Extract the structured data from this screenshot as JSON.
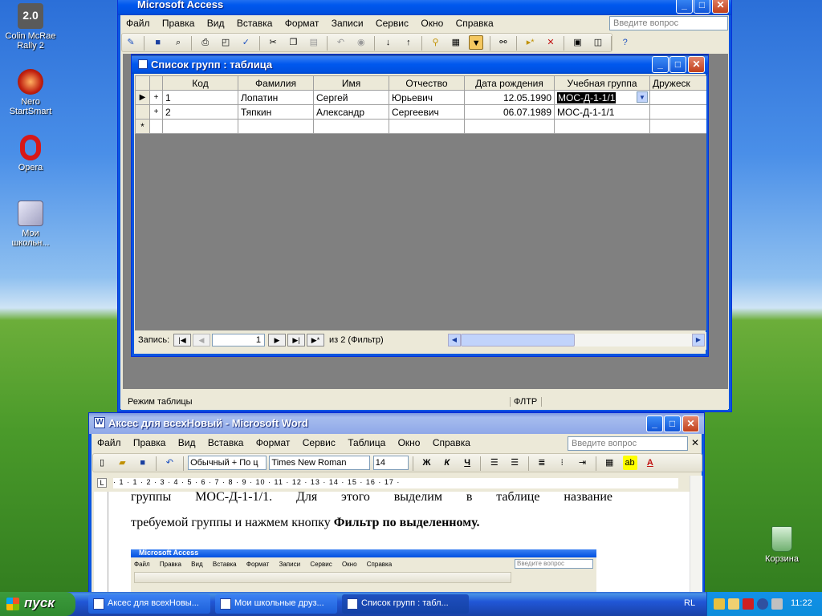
{
  "desktop": {
    "icons": [
      {
        "label": "Colin McRae\nRally 2",
        "badge": "2.0"
      },
      {
        "label": "Nero\nStartSmart"
      },
      {
        "label": "Opera"
      },
      {
        "label": "Мои\nшкольн..."
      },
      {
        "label": "Корзина"
      }
    ]
  },
  "access": {
    "title": "Microsoft Access",
    "menu": [
      "Файл",
      "Правка",
      "Вид",
      "Вставка",
      "Формат",
      "Записи",
      "Сервис",
      "Окно",
      "Справка"
    ],
    "ask_placeholder": "Введите вопрос",
    "status_left": "Режим таблицы",
    "status_mid": "ФЛТР",
    "table_window": {
      "title": "Список групп : таблица",
      "columns": [
        "Код",
        "Фамилия",
        "Имя",
        "Отчество",
        "Дата рождения",
        "Учебная группа",
        "Дружеск"
      ],
      "rows": [
        {
          "kod": "1",
          "familia": "Лопатин",
          "imya": "Сергей",
          "otchestvo": "Юрьевич",
          "date": "12.05.1990",
          "group": "МОС-Д-1-1/1"
        },
        {
          "kod": "2",
          "familia": "Тяпкин",
          "imya": "Александр",
          "otchestvo": "Сергеевич",
          "date": "06.07.1989",
          "group": "МОС-Д-1-1/1"
        }
      ],
      "nav_label": "Запись:",
      "nav_current": "1",
      "nav_of": "из  2 (Фильтр)"
    }
  },
  "word": {
    "title": "Аксес для всехНовый - Microsoft Word",
    "menu": [
      "Файл",
      "Правка",
      "Вид",
      "Вставка",
      "Формат",
      "Сервис",
      "Таблица",
      "Окно",
      "Справка"
    ],
    "ask_placeholder": "Введите вопрос",
    "style": "Обычный + По ц",
    "font": "Times New Roman",
    "size": "14",
    "ruler": "· 1 · 1 · 2 · 3 · 4 · 5 · 6 · 7 · 8 · 9 · 10 · 11 · 12 · 13 · 14 · 15 · 16 · 17 ·",
    "doc_line1": "группы МОС-Д-1-1/1. Для этого выделим в таблице название",
    "doc_line2_plain": "требуемой группы и нажмем кнопку ",
    "doc_line2_bold": "Фильтр по выделенному.",
    "embedded": {
      "title": "Microsoft Access",
      "menu": [
        "Файл",
        "Правка",
        "Вид",
        "Вставка",
        "Формат",
        "Записи",
        "Сервис",
        "Окно",
        "Справка"
      ],
      "ask_placeholder": "Введите вопрос"
    }
  },
  "taskbar": {
    "start": "пуск",
    "tasks": [
      "Аксес для всехНовы...",
      "Мои школьные друз...",
      "Список групп : табл..."
    ],
    "lang": "RL",
    "clock": "11:22"
  }
}
